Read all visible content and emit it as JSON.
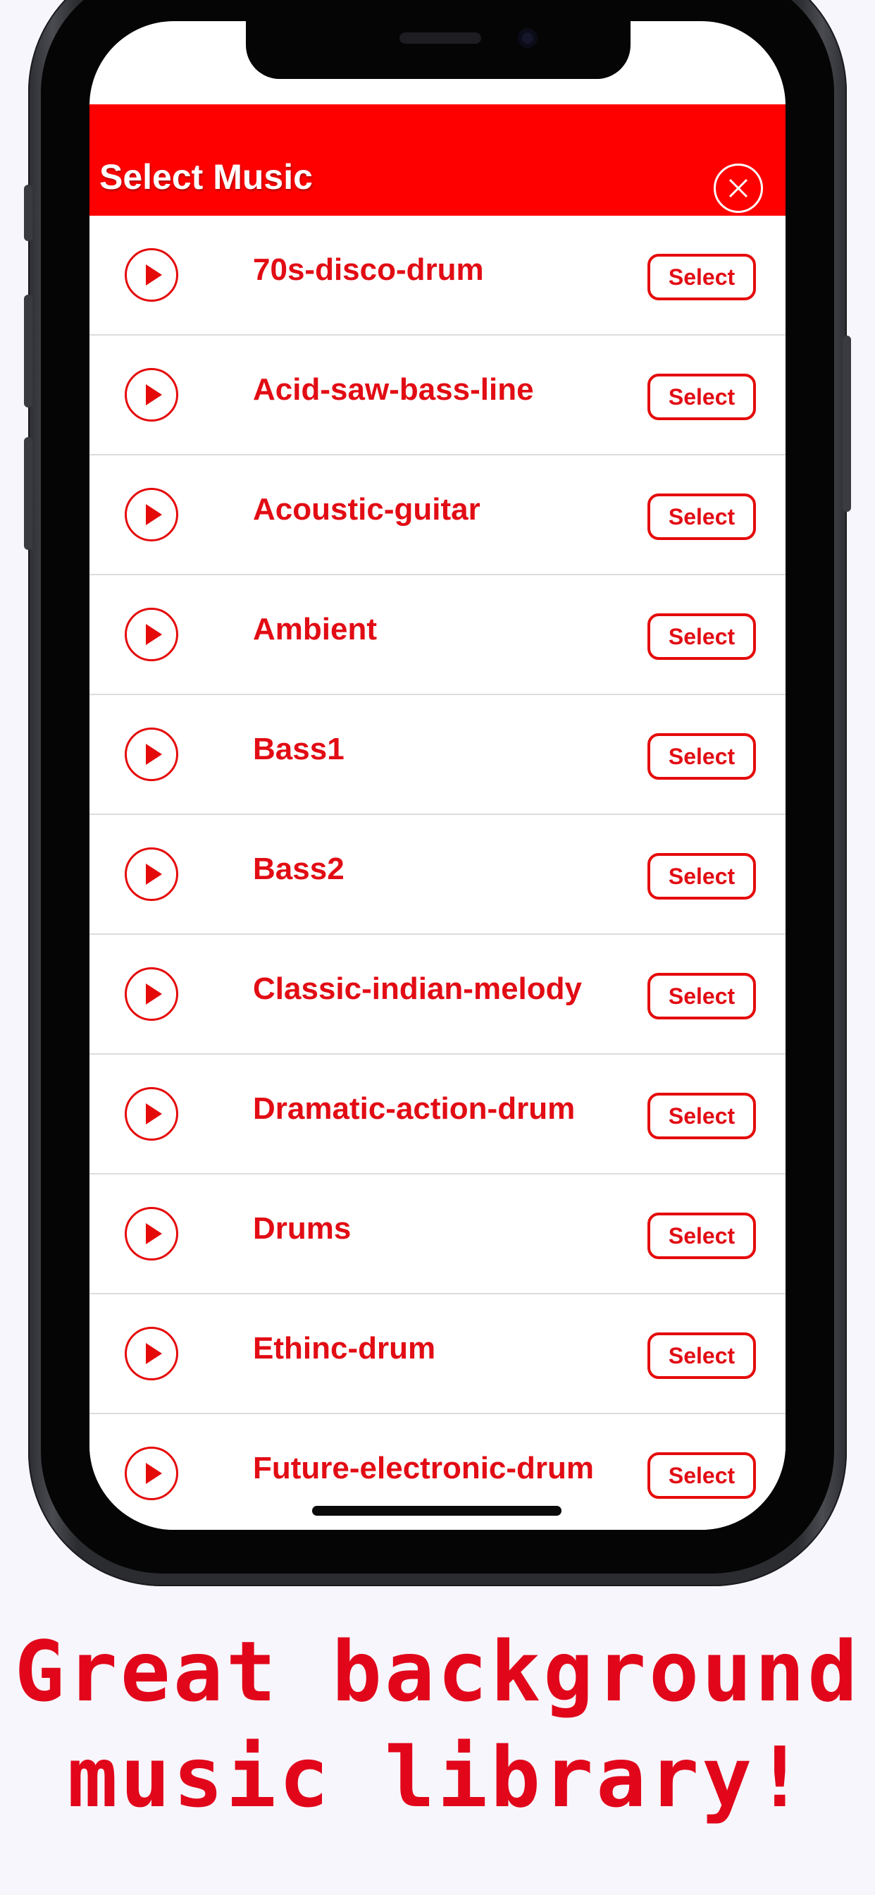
{
  "header": {
    "title": "Select Music",
    "close_icon": "close-circle-icon"
  },
  "tracks": [
    {
      "name": "70s-disco-drum",
      "action": "Select"
    },
    {
      "name": "Acid-saw-bass-line",
      "action": "Select"
    },
    {
      "name": "Acoustic-guitar",
      "action": "Select"
    },
    {
      "name": "Ambient",
      "action": "Select"
    },
    {
      "name": "Bass1",
      "action": "Select"
    },
    {
      "name": "Bass2",
      "action": "Select"
    },
    {
      "name": "Classic-indian-melody",
      "action": "Select"
    },
    {
      "name": "Dramatic-action-drum",
      "action": "Select"
    },
    {
      "name": "Drums",
      "action": "Select"
    },
    {
      "name": "Ethinc-drum",
      "action": "Select"
    },
    {
      "name": "Future-electronic-drum",
      "action": "Select"
    }
  ],
  "caption": {
    "line1": "Great background",
    "line2": "music library!"
  },
  "colors": {
    "accent": "#ff0000",
    "text_red": "#e20c14",
    "page_background": "#f7f6fd"
  },
  "icons": {
    "play": "play-circle-icon"
  }
}
